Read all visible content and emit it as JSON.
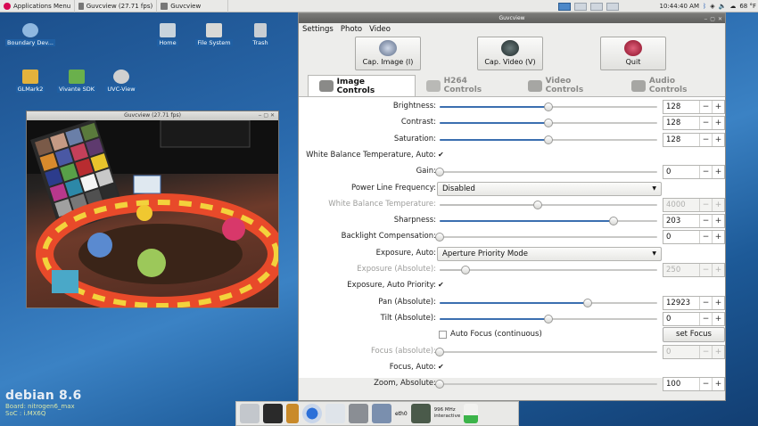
{
  "top_panel": {
    "apps_menu": "Applications Menu",
    "windows": [
      "Guvcview  (27.71 fps)",
      "Guvcview"
    ],
    "clock": "10:44:40 AM",
    "temp": "68 °F"
  },
  "desktop_icons": [
    {
      "label": "Boundary Dev...",
      "color": "#8fb8e0"
    },
    {
      "label": "Home",
      "color": "#c8d3dc"
    },
    {
      "label": "File System",
      "color": "#d9d9d6"
    },
    {
      "label": "Trash",
      "color": "#c9ced3"
    },
    {
      "label": "GLMark2",
      "color": "#e3b23c"
    },
    {
      "label": "Vivante SDK",
      "color": "#6ab04c"
    },
    {
      "label": "UVC-View",
      "color": "#d0d0d0"
    }
  ],
  "preview": {
    "title": "Guvcview  (27.71 fps)"
  },
  "guvcview": {
    "title": "Guvcview",
    "menu": [
      "Settings",
      "Photo",
      "Video"
    ],
    "buttons": {
      "cap_image": "Cap. Image (I)",
      "cap_video": "Cap. Video (V)",
      "quit": "Quit"
    },
    "tabs": [
      "Image Controls",
      "H264 Controls",
      "Video Controls",
      "Audio Controls"
    ],
    "controls": [
      {
        "label": "Brightness:",
        "value": "128",
        "level": 0.5
      },
      {
        "label": "Contrast:",
        "value": "128",
        "level": 0.5
      },
      {
        "label": "Saturation:",
        "value": "128",
        "level": 0.5
      },
      {
        "label": "White Balance Temperature, Auto:",
        "checked": "✔"
      },
      {
        "label": "Gain:",
        "value": "0",
        "level": 0.0
      },
      {
        "label": "Power Line Frequency:",
        "option": "Disabled"
      },
      {
        "label": "White Balance Temperature:",
        "value": "4000",
        "level": 0.45,
        "disabled": true
      },
      {
        "label": "Sharpness:",
        "value": "203",
        "level": 0.8
      },
      {
        "label": "Backlight Compensation:",
        "value": "0",
        "level": 0.0
      },
      {
        "label": "Exposure, Auto:",
        "option": "Aperture Priority Mode"
      },
      {
        "label": "Exposure (Absolute):",
        "value": "250",
        "level": 0.12,
        "disabled": true
      },
      {
        "label": "Exposure, Auto Priority:",
        "checked": "✔"
      },
      {
        "label": "Pan (Absolute):",
        "value": "12923",
        "level": 0.68
      },
      {
        "label": "Tilt (Absolute):",
        "value": "0",
        "level": 0.5
      },
      {
        "label": "",
        "checkbox_label": "Auto Focus (continuous)",
        "button": "set Focus"
      },
      {
        "label": "Focus (absolute):",
        "value": "0",
        "level": 0.0,
        "disabled": true
      },
      {
        "label": "Focus, Auto:",
        "checked": "✔"
      },
      {
        "label": "Zoom, Absolute:",
        "value": "100",
        "level": 0.0
      }
    ]
  },
  "debian": {
    "logo": "debian 8.6",
    "board": "Board: nitrogen6_max",
    "soc": "SoC   : i.MX6Q"
  },
  "taskbar": {
    "eth": "eth0",
    "freq": "996 MHz",
    "gov": "interactive"
  }
}
